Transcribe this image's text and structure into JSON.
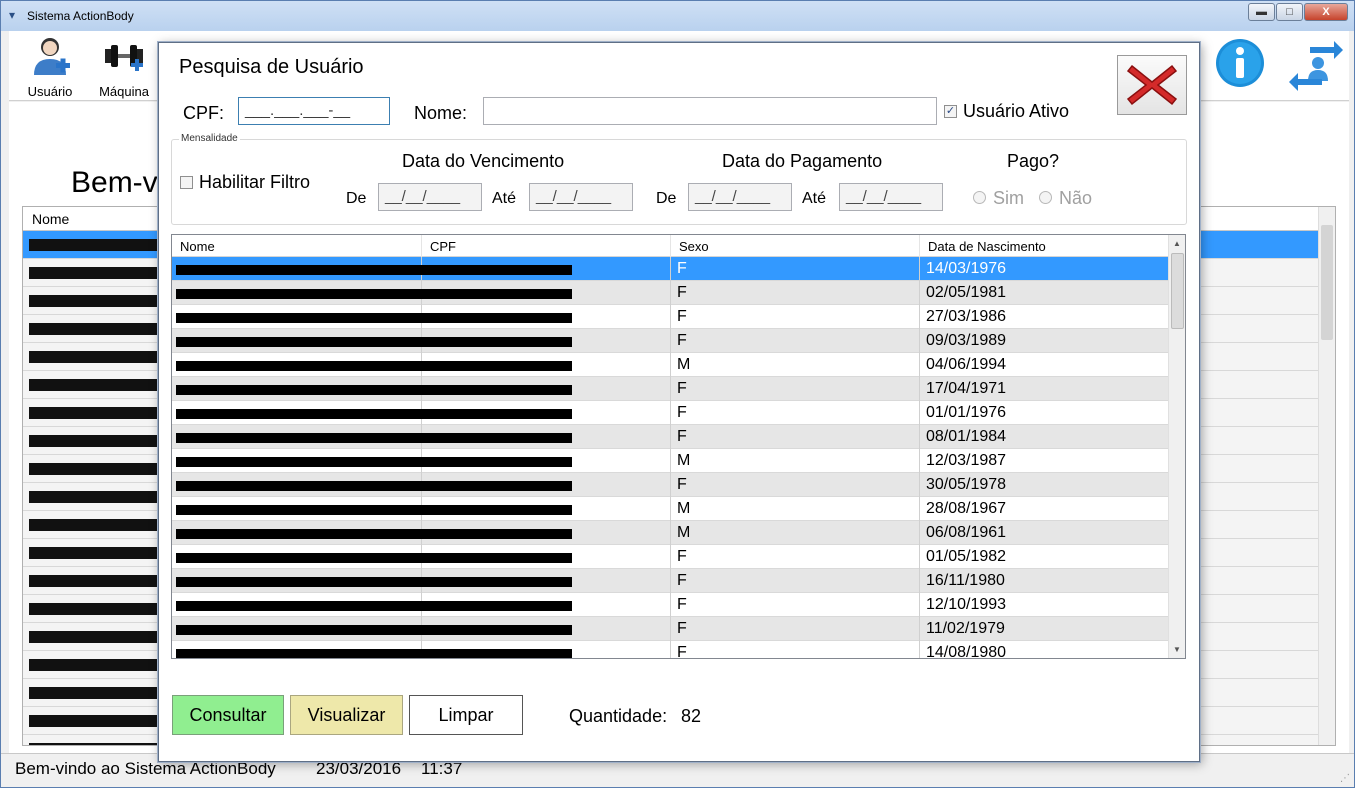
{
  "app": {
    "title": "Sistema ActionBody",
    "window_buttons": {
      "minimize": "▬",
      "maximize": "□",
      "close": "X"
    }
  },
  "toolbar": {
    "usuario_label": "Usuário",
    "maquina_label": "Máquina"
  },
  "background": {
    "welcome_title": "Bem-v",
    "grid_header": "Nome"
  },
  "status": {
    "text": "Bem-vindo ao Sistema ActionBody",
    "date": "23/03/2016",
    "time": "11:37"
  },
  "dialog": {
    "title": "Pesquisa de Usuário",
    "cpf_label": "CPF:",
    "cpf_value": "___.___.___-__",
    "nome_label": "Nome:",
    "nome_value": "",
    "usuario_ativo_label": "Usuário Ativo",
    "usuario_ativo_checked": true,
    "mensalidade": {
      "legend": "Mensalidade",
      "habilitar_filtro_label": "Habilitar Filtro",
      "habilitar_filtro_checked": false,
      "data_vencimento_label": "Data do Vencimento",
      "data_pagamento_label": "Data do Pagamento",
      "pago_label": "Pago?",
      "de_label": "De",
      "ate_label": "Até",
      "date_mask": "__/__/____",
      "sim_label": "Sim",
      "nao_label": "Não"
    },
    "grid": {
      "columns": [
        "Nome",
        "CPF",
        "Sexo",
        "Data de Nascimento"
      ],
      "rows": [
        {
          "sexo": "F",
          "nascimento": "14/03/1976",
          "selected": true
        },
        {
          "sexo": "F",
          "nascimento": "02/05/1981"
        },
        {
          "sexo": "F",
          "nascimento": "27/03/1986"
        },
        {
          "sexo": "F",
          "nascimento": "09/03/1989"
        },
        {
          "sexo": "M",
          "nascimento": "04/06/1994"
        },
        {
          "sexo": "F",
          "nascimento": "17/04/1971"
        },
        {
          "sexo": "F",
          "nascimento": "01/01/1976"
        },
        {
          "sexo": "F",
          "nascimento": "08/01/1984"
        },
        {
          "sexo": "M",
          "nascimento": "12/03/1987"
        },
        {
          "sexo": "F",
          "nascimento": "30/05/1978"
        },
        {
          "sexo": "M",
          "nascimento": "28/08/1967"
        },
        {
          "sexo": "M",
          "nascimento": "06/08/1961"
        },
        {
          "sexo": "F",
          "nascimento": "01/05/1982"
        },
        {
          "sexo": "F",
          "nascimento": "16/11/1980"
        },
        {
          "sexo": "F",
          "nascimento": "12/10/1993"
        },
        {
          "sexo": "F",
          "nascimento": "11/02/1979"
        },
        {
          "sexo": "F",
          "nascimento": "14/08/1980"
        }
      ]
    },
    "buttons": {
      "consultar": "Consultar",
      "visualizar": "Visualizar",
      "limpar": "Limpar"
    },
    "quantidade_label": "Quantidade:",
    "quantidade_value": "82"
  },
  "colors": {
    "selection": "#3399ff",
    "consultar_bg": "#90ee90",
    "visualizar_bg": "#eee8aa",
    "close_red": "#d42a2a"
  }
}
